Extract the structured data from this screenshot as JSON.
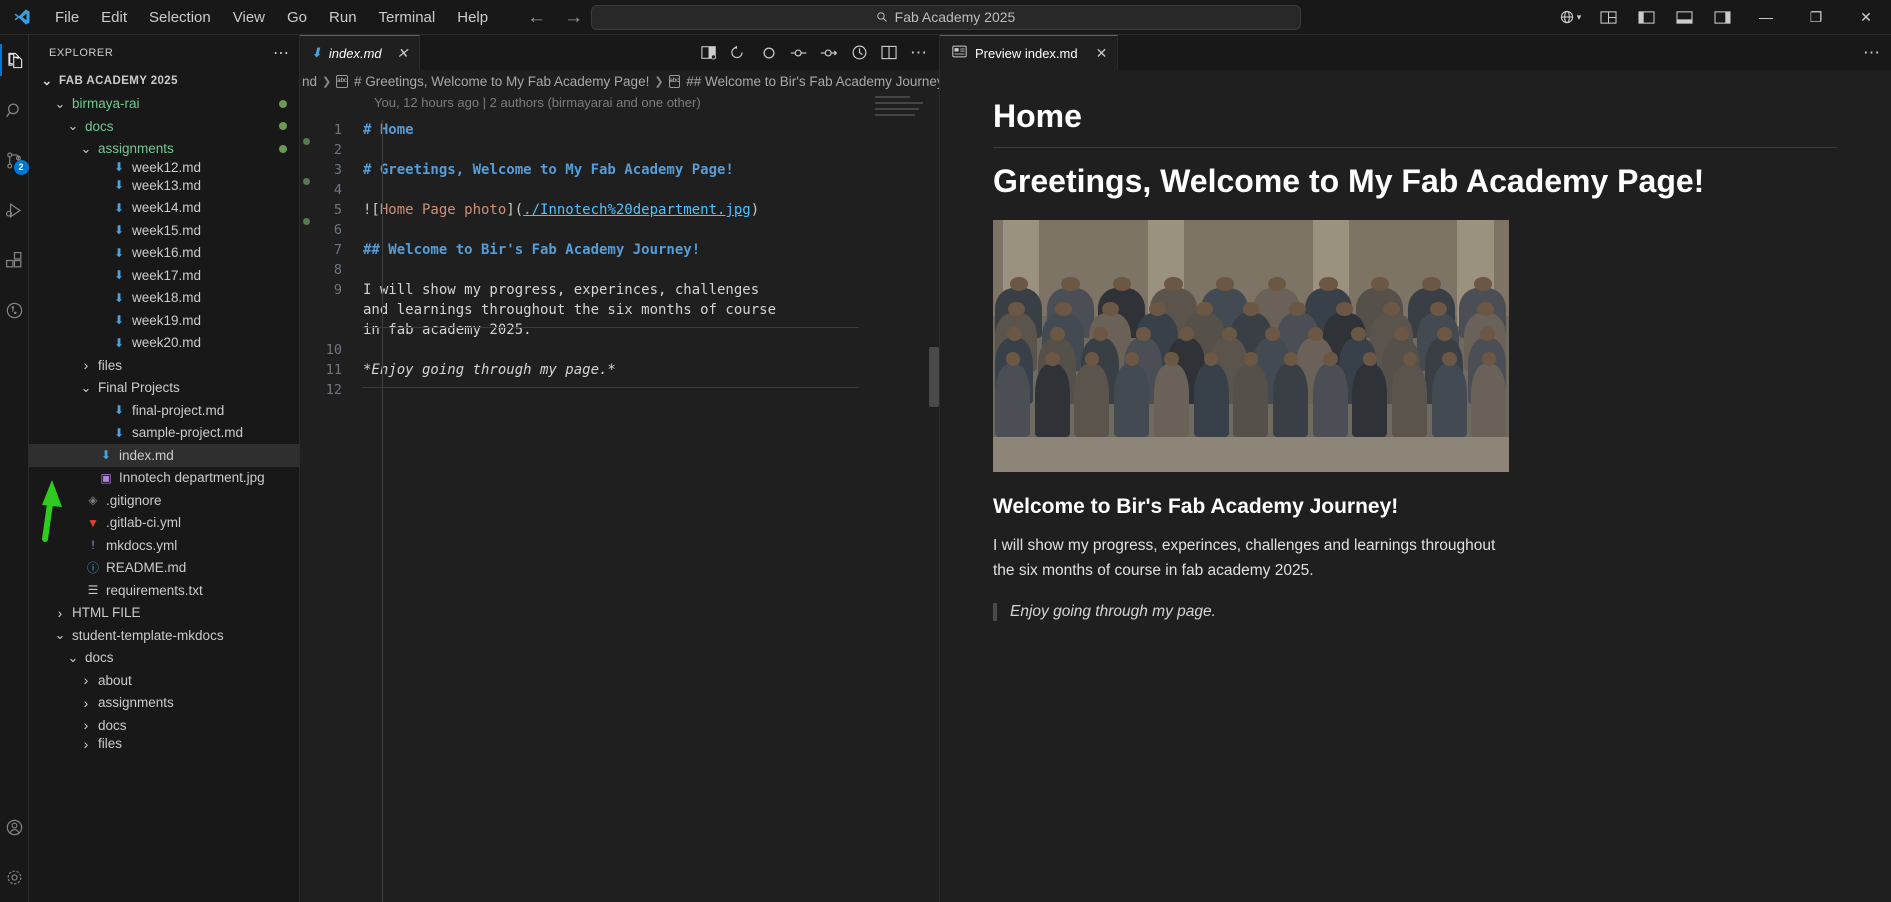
{
  "titlebar": {
    "logo_icon": "vscode-logo-icon",
    "menus": [
      "File",
      "Edit",
      "Selection",
      "View",
      "Go",
      "Run",
      "Terminal",
      "Help"
    ],
    "nav_back_icon": "arrow-left-icon",
    "nav_forward_icon": "arrow-right-icon",
    "command_center": {
      "search_icon": "search-icon",
      "text": "Fab Academy 2025"
    },
    "right_icons": [
      "remote-window-icon",
      "chevron-down-icon",
      "customize-layout-icon",
      "toggle-panel-icon",
      "toggle-secondary-icon",
      "toggle-sidebar-icon"
    ],
    "window_controls": {
      "minimize": "—",
      "maximize": "❐",
      "close": "✕"
    }
  },
  "activitybar": {
    "items": [
      {
        "name": "explorer",
        "icon": "files-icon",
        "active": true,
        "badge": ""
      },
      {
        "name": "search",
        "icon": "search-icon",
        "active": false,
        "badge": ""
      },
      {
        "name": "source-control",
        "icon": "source-control-icon",
        "active": false,
        "badge": "2"
      },
      {
        "name": "run-and-debug",
        "icon": "run-debug-icon",
        "active": false,
        "badge": ""
      },
      {
        "name": "extensions",
        "icon": "extensions-icon",
        "active": false,
        "badge": ""
      },
      {
        "name": "test-explorer",
        "icon": "beaker-icon",
        "active": false,
        "badge": ""
      }
    ],
    "bottom": [
      {
        "name": "accounts",
        "icon": "account-icon"
      },
      {
        "name": "manage",
        "icon": "gear-icon"
      }
    ]
  },
  "sidebar": {
    "title": "EXPLORER",
    "more_actions_icon": "ellipsis-icon",
    "tree": [
      {
        "label": "FAB ACADEMY 2025",
        "kind": "root",
        "depth": 0,
        "expanded": true,
        "icon": "",
        "dot": false,
        "green": false,
        "clipped": false
      },
      {
        "label": "birmaya-rai",
        "kind": "folder",
        "depth": 1,
        "expanded": true,
        "icon": "",
        "dot": true,
        "green": true,
        "clipped": false
      },
      {
        "label": "docs",
        "kind": "folder",
        "depth": 2,
        "expanded": true,
        "icon": "",
        "dot": true,
        "green": true,
        "clipped": false
      },
      {
        "label": "assignments",
        "kind": "folder",
        "depth": 3,
        "expanded": true,
        "icon": "",
        "dot": true,
        "green": true,
        "clipped": false
      },
      {
        "label": "week12.md",
        "kind": "file",
        "depth": 4,
        "expanded": false,
        "icon": "markdown-icon",
        "dot": false,
        "green": false,
        "clipped": true
      },
      {
        "label": "week13.md",
        "kind": "file",
        "depth": 4,
        "expanded": false,
        "icon": "markdown-icon",
        "dot": false,
        "green": false,
        "clipped": false
      },
      {
        "label": "week14.md",
        "kind": "file",
        "depth": 4,
        "expanded": false,
        "icon": "markdown-icon",
        "dot": false,
        "green": false,
        "clipped": false
      },
      {
        "label": "week15.md",
        "kind": "file",
        "depth": 4,
        "expanded": false,
        "icon": "markdown-icon",
        "dot": false,
        "green": false,
        "clipped": false
      },
      {
        "label": "week16.md",
        "kind": "file",
        "depth": 4,
        "expanded": false,
        "icon": "markdown-icon",
        "dot": false,
        "green": false,
        "clipped": false
      },
      {
        "label": "week17.md",
        "kind": "file",
        "depth": 4,
        "expanded": false,
        "icon": "markdown-icon",
        "dot": false,
        "green": false,
        "clipped": false
      },
      {
        "label": "week18.md",
        "kind": "file",
        "depth": 4,
        "expanded": false,
        "icon": "markdown-icon",
        "dot": false,
        "green": false,
        "clipped": false
      },
      {
        "label": "week19.md",
        "kind": "file",
        "depth": 4,
        "expanded": false,
        "icon": "markdown-icon",
        "dot": false,
        "green": false,
        "clipped": false
      },
      {
        "label": "week20.md",
        "kind": "file",
        "depth": 4,
        "expanded": false,
        "icon": "markdown-icon",
        "dot": false,
        "green": false,
        "clipped": false
      },
      {
        "label": "files",
        "kind": "folder",
        "depth": 3,
        "expanded": false,
        "icon": "",
        "dot": false,
        "green": false,
        "clipped": false
      },
      {
        "label": "Final Projects",
        "kind": "folder",
        "depth": 3,
        "expanded": true,
        "icon": "",
        "dot": false,
        "green": false,
        "clipped": false
      },
      {
        "label": "final-project.md",
        "kind": "file",
        "depth": 4,
        "expanded": false,
        "icon": "markdown-icon",
        "dot": false,
        "green": false,
        "clipped": false
      },
      {
        "label": "sample-project.md",
        "kind": "file",
        "depth": 4,
        "expanded": false,
        "icon": "markdown-icon",
        "dot": false,
        "green": false,
        "clipped": false
      },
      {
        "label": "index.md",
        "kind": "file",
        "depth": 3,
        "expanded": false,
        "icon": "markdown-icon",
        "dot": false,
        "green": false,
        "clipped": false,
        "selected": true
      },
      {
        "label": "Innotech department.jpg",
        "kind": "file",
        "depth": 3,
        "expanded": false,
        "icon": "image-icon",
        "dot": false,
        "green": false,
        "clipped": false
      },
      {
        "label": ".gitignore",
        "kind": "file",
        "depth": 2,
        "expanded": false,
        "icon": "gitignore-icon",
        "dot": false,
        "green": false,
        "clipped": false
      },
      {
        "label": ".gitlab-ci.yml",
        "kind": "file",
        "depth": 2,
        "expanded": false,
        "icon": "gitlab-icon",
        "dot": false,
        "green": false,
        "clipped": false
      },
      {
        "label": "mkdocs.yml",
        "kind": "file",
        "depth": 2,
        "expanded": false,
        "icon": "yaml-icon",
        "dot": false,
        "green": false,
        "clipped": false
      },
      {
        "label": "README.md",
        "kind": "file",
        "depth": 2,
        "expanded": false,
        "icon": "info-icon",
        "dot": false,
        "green": false,
        "clipped": false
      },
      {
        "label": "requirements.txt",
        "kind": "file",
        "depth": 2,
        "expanded": false,
        "icon": "text-icon",
        "dot": false,
        "green": false,
        "clipped": false
      },
      {
        "label": "HTML FILE",
        "kind": "folder",
        "depth": 1,
        "expanded": false,
        "icon": "",
        "dot": false,
        "green": false,
        "clipped": false
      },
      {
        "label": "student-template-mkdocs",
        "kind": "folder",
        "depth": 1,
        "expanded": true,
        "icon": "",
        "dot": false,
        "green": false,
        "clipped": false
      },
      {
        "label": "docs",
        "kind": "folder",
        "depth": 2,
        "expanded": true,
        "icon": "",
        "dot": false,
        "green": false,
        "clipped": false
      },
      {
        "label": "about",
        "kind": "folder",
        "depth": 3,
        "expanded": false,
        "icon": "",
        "dot": false,
        "green": false,
        "clipped": false
      },
      {
        "label": "assignments",
        "kind": "folder",
        "depth": 3,
        "expanded": false,
        "icon": "",
        "dot": false,
        "green": false,
        "clipped": false
      },
      {
        "label": "docs",
        "kind": "folder",
        "depth": 3,
        "expanded": false,
        "icon": "",
        "dot": false,
        "green": false,
        "clipped": false
      },
      {
        "label": "files",
        "kind": "folder",
        "depth": 3,
        "expanded": false,
        "icon": "",
        "dot": false,
        "green": false,
        "clipped": true
      }
    ],
    "annotation": {
      "type": "green-arrow",
      "points_to": "index.md",
      "color": "#2ecc1f"
    }
  },
  "editor": {
    "tab": {
      "label": "index.md",
      "icon": "markdown-icon",
      "close_icon": "close-icon",
      "italic": true
    },
    "actions": [
      "open-preview-to-side-icon",
      "run-code-icon",
      "debug-breakpoint-icon",
      "debug-step-icon",
      "debug-continue-icon",
      "timeline-icon",
      "split-editor-icon",
      "more-actions-icon"
    ],
    "breadcrumb": [
      {
        "label": "nd",
        "icon": ""
      },
      {
        "label": "# Greetings, Welcome to My Fab Academy Page!",
        "icon": "symbol-string-icon"
      },
      {
        "label": "## Welcome to Bir's Fab Academy Journey!",
        "icon": "symbol-string-icon"
      }
    ],
    "blame": "You, 12 hours ago | 2 authors (birmayarai and one other)",
    "lines": [
      {
        "num": "1",
        "segs": [
          {
            "t": "# Home",
            "c": "md-head"
          }
        ]
      },
      {
        "num": "2",
        "segs": []
      },
      {
        "num": "3",
        "segs": [
          {
            "t": "# Greetings, Welcome to My Fab Academy Page!",
            "c": "md-head"
          }
        ]
      },
      {
        "num": "4",
        "segs": []
      },
      {
        "num": "5",
        "segs": [
          {
            "t": "![",
            "c": "md-punct"
          },
          {
            "t": "Home Page photo",
            "c": "md-link-text"
          },
          {
            "t": "](",
            "c": "md-punct"
          },
          {
            "t": "./Innotech%20department.jpg",
            "c": "md-url"
          },
          {
            "t": ")",
            "c": "md-punct"
          }
        ]
      },
      {
        "num": "6",
        "segs": []
      },
      {
        "num": "7",
        "segs": [
          {
            "t": "## Welcome to Bir's Fab Academy Journey!",
            "c": "md-head"
          }
        ]
      },
      {
        "num": "8",
        "segs": []
      },
      {
        "num": "9",
        "wrapped": true,
        "segs": [
          {
            "t": "I will show my progress, experinces, challenges and learnings throughout the six months of course in fab academy 2025.",
            "c": "md-plain"
          }
        ]
      },
      {
        "num": "10",
        "segs": []
      },
      {
        "num": "11",
        "segs": [
          {
            "t": "*Enjoy going through my page.*",
            "c": "md-ital"
          }
        ]
      },
      {
        "num": "12",
        "segs": []
      }
    ]
  },
  "preview": {
    "tab": {
      "label": "Preview index.md",
      "icon": "preview-icon",
      "close_icon": "close-icon"
    },
    "more_actions_icon": "ellipsis-icon",
    "h1": "Home",
    "h1b": "Greetings, Welcome to My Fab Academy Page!",
    "image_alt": "Home Page photo",
    "h2": "Welcome to Bir's Fab Academy Journey!",
    "paragraph": "I will show my progress, experinces, challenges and learnings throughout the six months of course in fab academy 2025.",
    "quote": "Enjoy going through my page."
  },
  "colors": {
    "accent": "#0078d4",
    "heading_blue": "#569cd6",
    "link_url": "#4fc1ff",
    "link_text": "#ce9178",
    "folder_green": "#73c991",
    "annotation_green": "#2ecc1f"
  }
}
